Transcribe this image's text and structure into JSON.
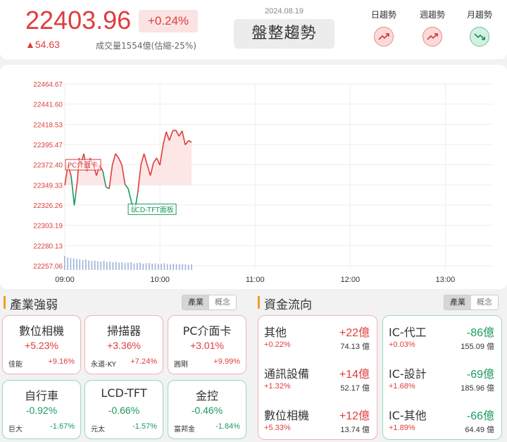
{
  "header": {
    "index_value": "22403.96",
    "change_pct": "+0.24%",
    "change_pts": "▲54.63",
    "volume": "成交量1554億(估縮-25%)",
    "date": "2024.08.19",
    "trend_status": "盤整趨勢",
    "trends": [
      {
        "label": "日趨勢",
        "direction": "up",
        "icon": "trend-up-icon"
      },
      {
        "label": "週趨勢",
        "direction": "up",
        "icon": "trend-up-icon"
      },
      {
        "label": "月趨勢",
        "direction": "down",
        "icon": "trend-down-icon"
      }
    ]
  },
  "chart_data": {
    "type": "line",
    "y_ticks": [
      "22464.67",
      "22441.60",
      "22418.53",
      "22395.47",
      "22372.40",
      "22349.33",
      "22326.26",
      "22303.19",
      "22280.13",
      "22257.06"
    ],
    "x_ticks": [
      "09:00",
      "10:00",
      "11:00",
      "12:00",
      "13:00"
    ],
    "ylim": [
      22257.06,
      22464.67
    ],
    "xlim_minutes": [
      0,
      270
    ],
    "reference_value": 22349.33,
    "series": [
      {
        "x": [
          0,
          2,
          4,
          6,
          7,
          8,
          9,
          10,
          12,
          14,
          16,
          18,
          20,
          22,
          24,
          26,
          28,
          30,
          32,
          34,
          36,
          38,
          40,
          42,
          44,
          46,
          48,
          50,
          52,
          54,
          56,
          58,
          60,
          62,
          64,
          66,
          68,
          70,
          72,
          74,
          76,
          78,
          80
        ],
        "y": [
          22349,
          22372,
          22360,
          22326,
          22340,
          22355,
          22380,
          22372,
          22385,
          22365,
          22380,
          22372,
          22360,
          22372,
          22365,
          22347,
          22345,
          22372,
          22385,
          22380,
          22372,
          22350,
          22345,
          22330,
          22318,
          22340,
          22372,
          22385,
          22372,
          22360,
          22375,
          22380,
          22372,
          22395,
          22410,
          22400,
          22411,
          22412,
          22405,
          22411,
          22395,
          22400,
          22398
        ]
      }
    ],
    "volume_bars": [
      40,
      36,
      34,
      33,
      31,
      30,
      28,
      30,
      27,
      26,
      27,
      25,
      24,
      26,
      23,
      24,
      22,
      23,
      21,
      22,
      20,
      21,
      22,
      19,
      20,
      21,
      18,
      19,
      20,
      18,
      19,
      17,
      18,
      19,
      17,
      16,
      18,
      17,
      16,
      17,
      16,
      15,
      16
    ],
    "annotations": [
      {
        "label": "PC介面卡",
        "x": 4,
        "y": 22372,
        "color": "#e03c3c"
      },
      {
        "label": "LCD-TFT面板",
        "x": 40,
        "y": 22326,
        "color": "#1a9a5e"
      }
    ]
  },
  "industry": {
    "title": "產業強弱",
    "toggle_on": "產業",
    "toggle_off": "概念",
    "cards": [
      {
        "name": "數位相機",
        "pct": "+5.23%",
        "stock": "佳能",
        "stock_pct": "+9.16%",
        "dir": "up"
      },
      {
        "name": "掃描器",
        "pct": "+3.36%",
        "stock": "永道-KY",
        "stock_pct": "+7.24%",
        "dir": "up"
      },
      {
        "name": "PC介面卡",
        "pct": "+3.01%",
        "stock": "圓剛",
        "stock_pct": "+9.99%",
        "dir": "up"
      },
      {
        "name": "自行車",
        "pct": "-0.92%",
        "stock": "巨大",
        "stock_pct": "-1.67%",
        "dir": "down"
      },
      {
        "name": "LCD-TFT",
        "pct": "-0.66%",
        "stock": "元太",
        "stock_pct": "-1.57%",
        "dir": "down"
      },
      {
        "name": "金控",
        "pct": "-0.46%",
        "stock": "富邦金",
        "stock_pct": "-1.84%",
        "dir": "down"
      }
    ]
  },
  "fund_flow": {
    "title": "資金流向",
    "toggle_on": "產業",
    "toggle_off": "概念",
    "inflow": [
      {
        "name": "其他",
        "amount": "+22億",
        "pct": "+0.22%",
        "value": "74.13 億"
      },
      {
        "name": "通訊設備",
        "amount": "+14億",
        "pct": "+1.32%",
        "value": "52.17 億"
      },
      {
        "name": "數位相機",
        "amount": "+12億",
        "pct": "+5.33%",
        "value": "13.74 億"
      }
    ],
    "outflow": [
      {
        "name": "IC-代工",
        "amount": "-86億",
        "pct": "+0.03%",
        "value": "155.09 億"
      },
      {
        "name": "IC-設計",
        "amount": "-69億",
        "pct": "+1.68%",
        "value": "185.96 億"
      },
      {
        "name": "IC-其他",
        "amount": "-66億",
        "pct": "+1.89%",
        "value": "64.49 億"
      }
    ]
  },
  "colors": {
    "up": "#e03c3c",
    "down": "#1a9a5e",
    "accent": "#f0a020"
  }
}
